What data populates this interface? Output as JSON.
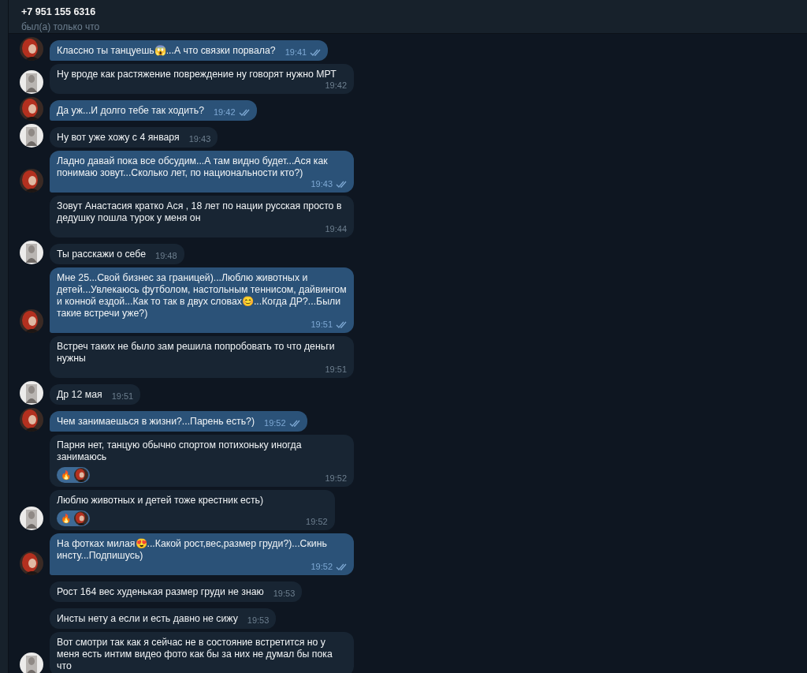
{
  "header": {
    "title": "+7 951 155 6316",
    "status": "был(а) только что"
  },
  "messages": [
    {
      "kind": "out",
      "text": "Классно ты танцуешь😱...А что связки порвала?",
      "time": "19:41",
      "read": true,
      "avatar": true
    },
    {
      "kind": "in",
      "text": "Ну вроде как растяжение повреждение ну говорят нужно МРТ",
      "time": "19:42",
      "avatar": true
    },
    {
      "kind": "out",
      "text": "Да уж...И долго тебе так ходить?",
      "time": "19:42",
      "read": true,
      "avatar": true
    },
    {
      "kind": "in",
      "text": "Ну вот уже хожу с 4 января",
      "time": "19:43",
      "avatar": true
    },
    {
      "kind": "out",
      "text": "Ладно давай пока все обсудим...А там видно будет...Ася как понимаю зовут...Сколько лет, по национальности кто?)",
      "time": "19:43",
      "read": true,
      "avatar": true
    },
    {
      "kind": "in",
      "text": "Зовут Анастасия кратко Ася , 18 лет по нации русская просто в дедушку пошла турок у меня он",
      "time": "19:44",
      "avatar": false
    },
    {
      "kind": "in",
      "text": "Ты расскажи о себе",
      "time": "19:48",
      "avatar": true
    },
    {
      "kind": "out",
      "text": "Мне 25...Свой бизнес за границей)...Люблю животных и детей...Увлекаюсь футболом, настольным теннисом, дайвингом и конной ездой...Как то так в двух словах😊...Когда ДР?...Были такие встречи уже?)",
      "time": "19:51",
      "read": true,
      "avatar": true
    },
    {
      "kind": "in",
      "text": "Встреч таких не было зам решила попробовать то что деньги нужны",
      "time": "19:51",
      "avatar": false
    },
    {
      "kind": "in",
      "text": "Др 12 мая",
      "time": "19:51",
      "avatar": true
    },
    {
      "kind": "out",
      "text": "Чем занимаешься в жизни?...Парень есть?)",
      "time": "19:52",
      "read": true,
      "avatar": true
    },
    {
      "kind": "in",
      "text": "Парня нет, танцую обычно спортом потихоньку иногда занимаюсь",
      "time": "19:52",
      "avatar": false,
      "reactions": [
        {
          "emoji": "🔥"
        }
      ]
    },
    {
      "kind": "in",
      "text": "Люблю животных и детей тоже крестник есть)",
      "time": "19:52",
      "avatar": true,
      "reactions": [
        {
          "emoji": "🔥"
        }
      ]
    },
    {
      "kind": "out",
      "text": "На фотках милая😍...Какой рост,вес,размер груди?)...Скинь инсту...Подпишусь)",
      "time": "19:52",
      "read": true,
      "avatar": true
    },
    {
      "kind": "in",
      "text": "Рост 164 вес худенькая размер груди не знаю",
      "time": "19:53",
      "avatar": false
    },
    {
      "kind": "in",
      "text": "Инсты нету а если и есть давно не сижу",
      "time": "19:53",
      "avatar": false
    },
    {
      "kind": "in",
      "text": "Вот смотри так как я сейчас не в состояние встретится но у меня есть интим видео фото как бы за них не думал бы пока что",
      "avatar": true
    }
  ]
}
